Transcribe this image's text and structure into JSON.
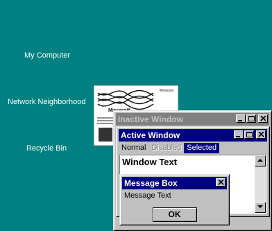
{
  "desktop": {
    "icons": [
      {
        "label": "My Computer"
      },
      {
        "label": "Network Neighborhood"
      },
      {
        "label": "Recycle Bin"
      }
    ]
  },
  "wallpaper": {
    "corner_text": "Windows",
    "brand_text": "Microsoft"
  },
  "inactive_window": {
    "title": "Inactive Window"
  },
  "active_window": {
    "title": "Active Window",
    "menu": {
      "normal": "Normal",
      "disabled": "Disabled",
      "selected": "Selected"
    },
    "window_text": "Window Text"
  },
  "message_box": {
    "title": "Message Box",
    "message": "Message Text",
    "ok_label": "OK"
  },
  "colors": {
    "desktop": "#008080",
    "active_title": "#000080",
    "inactive_title": "#808080",
    "face": "#c0c0c0"
  }
}
